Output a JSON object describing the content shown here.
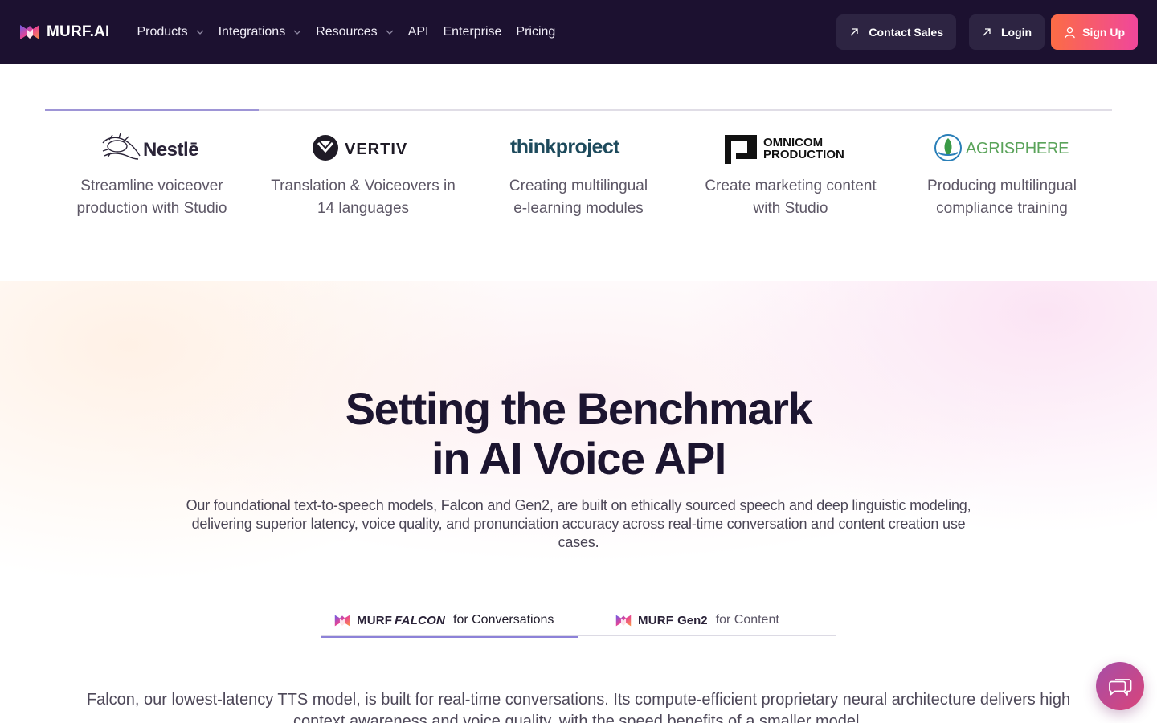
{
  "nav": {
    "logo_text": "MURF.AI",
    "menu": [
      {
        "label": "Products",
        "has_dropdown": true
      },
      {
        "label": "Integrations",
        "has_dropdown": true
      },
      {
        "label": "Resources",
        "has_dropdown": true
      },
      {
        "label": "API",
        "has_dropdown": false
      },
      {
        "label": "Enterprise",
        "has_dropdown": false
      },
      {
        "label": "Pricing",
        "has_dropdown": false
      }
    ],
    "contact_label": "Contact Sales",
    "login_label": "Login",
    "signup_label": "Sign Up"
  },
  "customers": {
    "items": [
      {
        "logo": "Nestlē",
        "desc": "Streamline voiceover\nproduction with Studio"
      },
      {
        "logo": "VERTIV",
        "desc": "Translation & Voiceovers in\n14 languages"
      },
      {
        "logo": "thinkproject",
        "desc": "Creating multilingual\ne-learning modules"
      },
      {
        "logo_line1": "OMNICOM",
        "logo_line2": "PRODUCTION",
        "desc": "Create marketing content\nwith Studio"
      },
      {
        "logo": "AGRISPHERE",
        "desc": "Producing multilingual\ncompliance training"
      }
    ]
  },
  "hero": {
    "title_line1": "Setting the Benchmark",
    "title_line2": "in AI Voice API",
    "subtext": "Our foundational text-to-speech models, Falcon and Gen2, are built on ethically sourced speech and deep linguistic modeling, delivering superior latency, voice quality, and pronunciation accuracy across real-time conversation and content creation use cases.",
    "tabs": [
      {
        "brand": "MURF",
        "model": "FALCON",
        "suffix": "for Conversations",
        "active": true
      },
      {
        "brand": "MURF",
        "model": "Gen2",
        "suffix": "for Content",
        "active": false
      }
    ],
    "falcon_desc": "Falcon, our lowest-latency TTS model, is built for real-time conversations. Its compute-efficient proprietary neural architecture delivers high context awareness and voice quality, with the speed benefits of a smaller model."
  },
  "colors": {
    "nav_bg": "#1c1130",
    "accent_gradient_start": "#fc6c45",
    "accent_gradient_end": "#f0479b",
    "tab_active": "#8d82d8"
  },
  "icons": {
    "chat": "chat-bubbles-icon",
    "chevron": "chevron-down-icon",
    "arrow": "arrow-up-right-icon",
    "user": "user-icon"
  }
}
